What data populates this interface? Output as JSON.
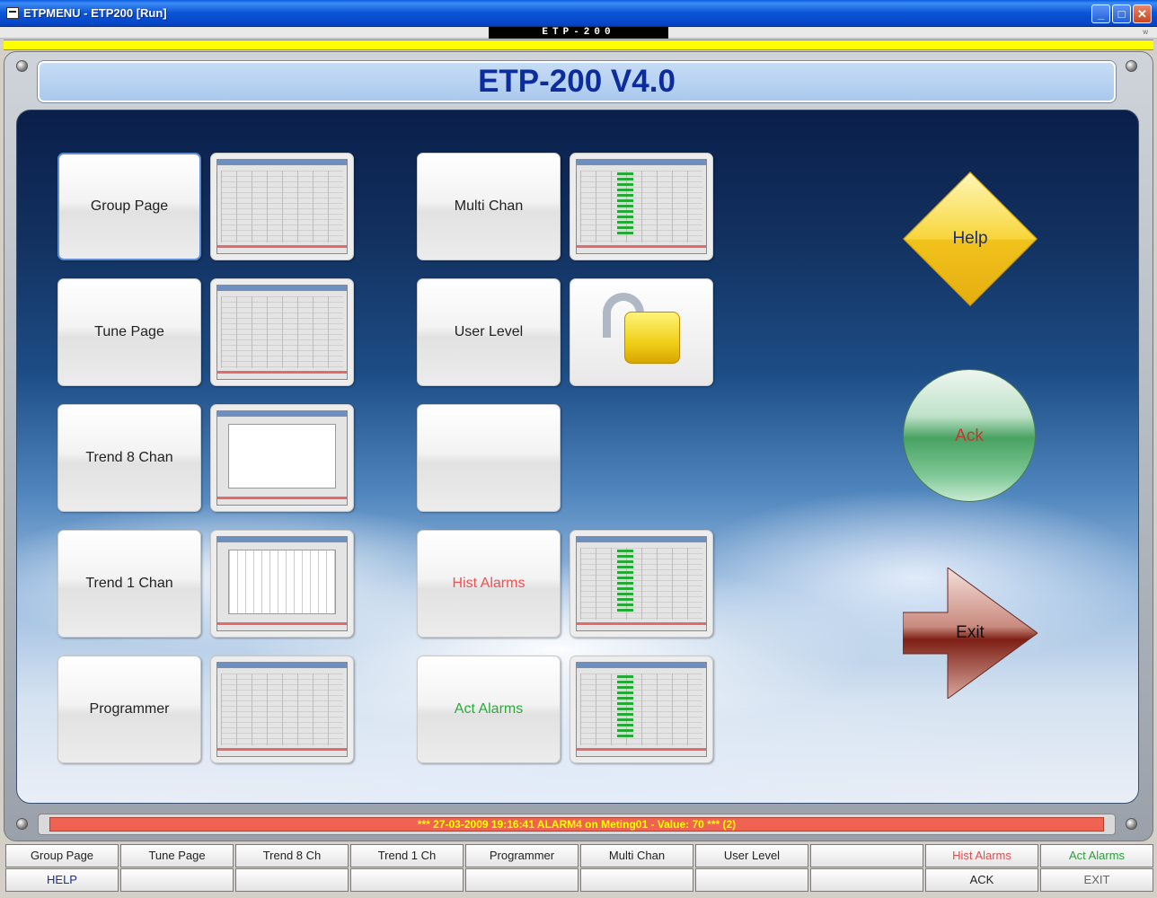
{
  "window": {
    "title": "ETPMENU - ETP200 [Run]",
    "minimize": "_",
    "maximize": "□",
    "close": "✕"
  },
  "top_tag": "ETP-200",
  "top_right_mark": "w",
  "header": {
    "title": "ETP-200 V4.0"
  },
  "tiles": {
    "group_page": "Group Page",
    "tune_page": "Tune Page",
    "trend8": "Trend 8 Chan",
    "trend1": "Trend 1 Chan",
    "programmer": "Programmer",
    "multi_chan": "Multi Chan",
    "user_level": "User Level",
    "empty": "",
    "hist_alarms": "Hist Alarms",
    "act_alarms": "Act Alarms"
  },
  "side_buttons": {
    "help": "Help",
    "ack": "Ack",
    "exit": "Exit"
  },
  "status_message": "*** 27-03-2009 19:16:41   ALARM4  on Meting01 - Value: 70 *** (2)",
  "bottom_row1": [
    "Group Page",
    "Tune Page",
    "Trend 8 Ch",
    "Trend 1 Ch",
    "Programmer",
    "Multi Chan",
    "User Level",
    "",
    "Hist Alarms",
    "Act Alarms"
  ],
  "bottom_row2": [
    "HELP",
    "",
    "",
    "",
    "",
    "",
    "",
    "",
    "ACK",
    "EXIT"
  ],
  "colors": {
    "title_bar": "#0a54d6",
    "header_text": "#0c2c9c",
    "status_bg": "#f06352",
    "status_text": "#ffff00",
    "hist_alarms": "#f05050",
    "act_alarms": "#2caa3a"
  }
}
